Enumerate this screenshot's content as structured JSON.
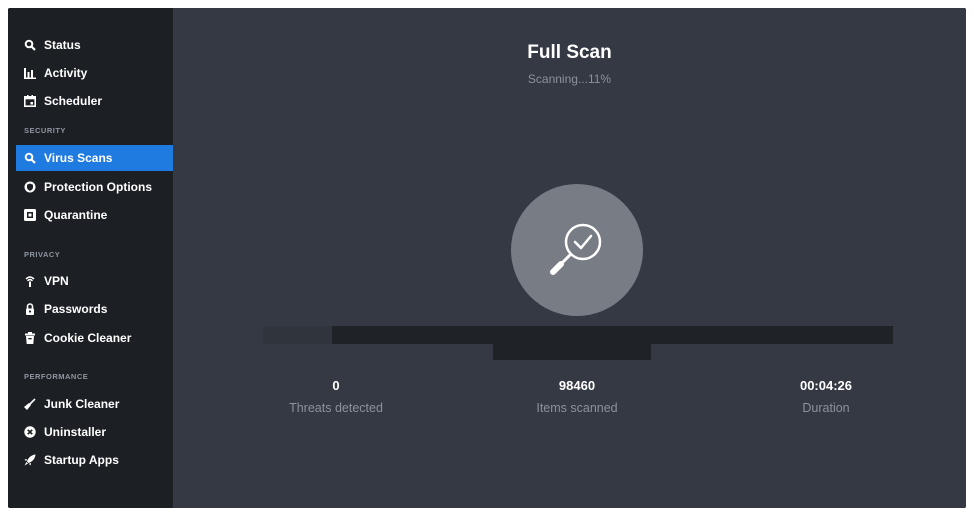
{
  "sidebar": {
    "items_top": [
      {
        "label": "Status",
        "icon": "search-icon"
      },
      {
        "label": "Activity",
        "icon": "bar-chart-icon"
      },
      {
        "label": "Scheduler",
        "icon": "calendar-icon"
      }
    ],
    "sections": {
      "security": "SECURITY",
      "privacy": "PRIVACY",
      "performance": "PERFORMANCE"
    },
    "security_items": [
      {
        "label": "Virus Scans",
        "icon": "search-icon",
        "active": true
      },
      {
        "label": "Protection Options",
        "icon": "shield-icon"
      },
      {
        "label": "Quarantine",
        "icon": "quarantine-icon"
      }
    ],
    "privacy_items": [
      {
        "label": "VPN",
        "icon": "wifi-icon"
      },
      {
        "label": "Passwords",
        "icon": "lock-icon"
      },
      {
        "label": "Cookie Cleaner",
        "icon": "trash-icon"
      }
    ],
    "performance_items": [
      {
        "label": "Junk Cleaner",
        "icon": "broom-icon"
      },
      {
        "label": "Uninstaller",
        "icon": "close-circle-icon"
      },
      {
        "label": "Startup Apps",
        "icon": "rocket-icon"
      }
    ]
  },
  "scan": {
    "title": "Full Scan",
    "status": "Scanning...11%",
    "progress": 0.11,
    "center_icon": "magnifier-check-icon"
  },
  "stats": {
    "threats": {
      "value": "0",
      "label": "Threats detected"
    },
    "items": {
      "value": "98460",
      "label": "Items scanned"
    },
    "duration": {
      "value": "00:04:26",
      "label": "Duration"
    }
  },
  "colors": {
    "accent": "#1f7be0",
    "sidebar_bg": "#1c1f24",
    "main_bg": "#353943"
  }
}
